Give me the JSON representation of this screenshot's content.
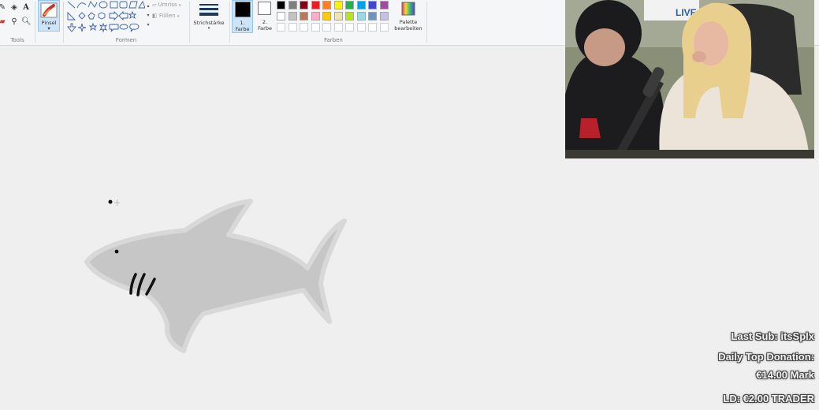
{
  "ribbon": {
    "tools": {
      "label": "Tools"
    },
    "brush": {
      "label": "Pinsel"
    },
    "shapes": {
      "label": "Formen",
      "outline_label": "Umriss",
      "fill_label": "Füllen"
    },
    "stroke": {
      "label": "Strichstärke"
    },
    "color1": {
      "label_line1": "1.",
      "label_line2": "Farbe",
      "value": "#000000"
    },
    "color2": {
      "label_line1": "2.",
      "label_line2": "Farbe",
      "value": "#ffffff"
    },
    "colors": {
      "label": "Farben",
      "row1": [
        "#000000",
        "#7f7f7f",
        "#880015",
        "#ed1c24",
        "#ff7f27",
        "#fff200",
        "#22b14c",
        "#00a2e8",
        "#3f48cc",
        "#a349a4"
      ],
      "row2": [
        "#ffffff",
        "#c3c3c3",
        "#b97a57",
        "#ffaec9",
        "#ffc90e",
        "#efe4b0",
        "#b5e61d",
        "#99d9ea",
        "#7092be",
        "#c8bfe7"
      ]
    },
    "edit_palette": {
      "label_line1": "Palette",
      "label_line2": "bearbeiten"
    }
  },
  "overlay": {
    "last_sub": "Last Sub: itsSplx",
    "daily_top_donation": "Daily Top Donation:",
    "donation_amount": "€14.00 Mark",
    "ld": "LD:  €2.00 TRADER"
  },
  "webcam": {
    "logo_text": "LIVE"
  },
  "colors": {
    "shark_fill": "#c4c4c4",
    "shark_outline": "#d6d6d6",
    "canvas_bg": "#efefef"
  }
}
